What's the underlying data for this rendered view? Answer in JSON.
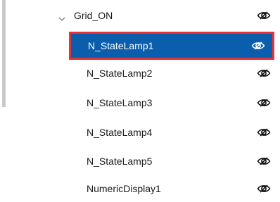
{
  "tree": {
    "group": {
      "label": "Grid_ON",
      "expanded": true
    },
    "items": [
      {
        "label": "N_StateLamp1",
        "selected": true
      },
      {
        "label": "N_StateLamp2",
        "selected": false
      },
      {
        "label": "N_StateLamp3",
        "selected": false
      },
      {
        "label": "N_StateLamp4",
        "selected": false
      },
      {
        "label": "N_StateLamp5",
        "selected": false
      },
      {
        "label": "NumericDisplay1",
        "selected": false
      }
    ]
  },
  "colors": {
    "selected_bg": "#0a5eab",
    "selected_border": "#e0343a",
    "text": "#1a1a1a",
    "selected_text": "#ffffff"
  },
  "icons": {
    "expand": "chevron-down-icon",
    "visibility": "eye-icon"
  }
}
